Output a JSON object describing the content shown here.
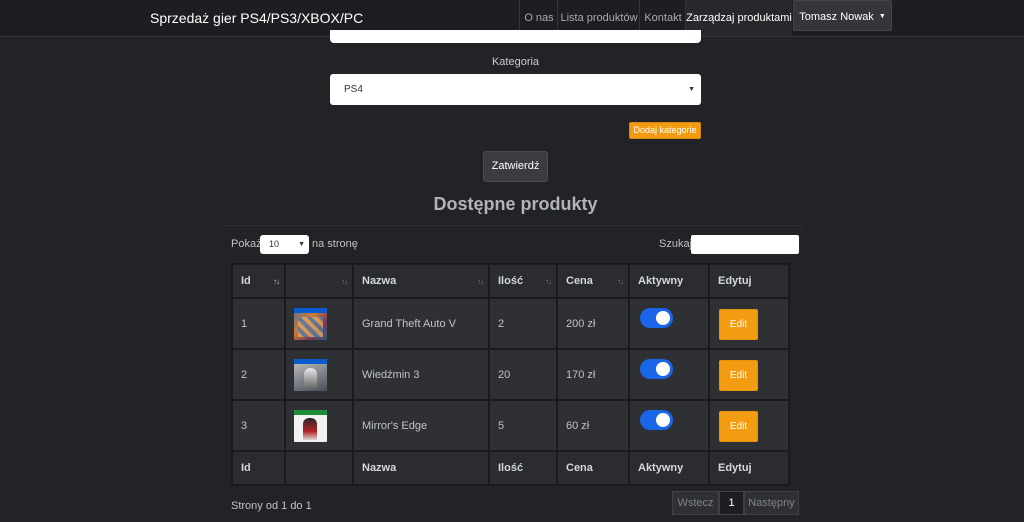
{
  "navbar": {
    "brand": "Sprzedaż gier PS4/PS3/XBOX/PC",
    "links": [
      {
        "label": "O nas"
      },
      {
        "label": "Lista produktów"
      },
      {
        "label": "Kontakt"
      },
      {
        "label": "Zarządzaj produktami",
        "active": true
      }
    ],
    "user": "Tomasz Nowak"
  },
  "form": {
    "category_label": "Kategoria",
    "category_value": "PS4",
    "add_category": "Dodaj kategorie",
    "submit": "Zatwierdź"
  },
  "section_title": "Dostępne produkty",
  "table_controls": {
    "show_prefix": "Pokaż",
    "page_size": "10",
    "show_suffix": "na stronę",
    "search_label": "Szukaj"
  },
  "table": {
    "headers": [
      "Id",
      "",
      "Nazwa",
      "Ilość",
      "Cena",
      "Aktywny",
      "Edytuj"
    ],
    "rows": [
      {
        "id": "1",
        "cover": "gta-cover-image",
        "name": "Grand Theft Auto V",
        "qty": "2",
        "price": "200 zł",
        "active": true,
        "edit": "Edit"
      },
      {
        "id": "2",
        "cover": "witcher-cover-image",
        "name": "Wiedźmin 3",
        "qty": "20",
        "price": "170 zł",
        "active": true,
        "edit": "Edit"
      },
      {
        "id": "3",
        "cover": "mirrors-edge-cover-image",
        "name": "Mirror's Edge",
        "qty": "5",
        "price": "60 zł",
        "active": true,
        "edit": "Edit"
      }
    ]
  },
  "pagination": {
    "info": "Strony od 1 do 1",
    "prev": "Wstecz",
    "current": "1",
    "next": "Następny"
  },
  "colors": {
    "accent": "#f39c12",
    "toggle_on": "#1a66e8",
    "background": "#222327"
  }
}
